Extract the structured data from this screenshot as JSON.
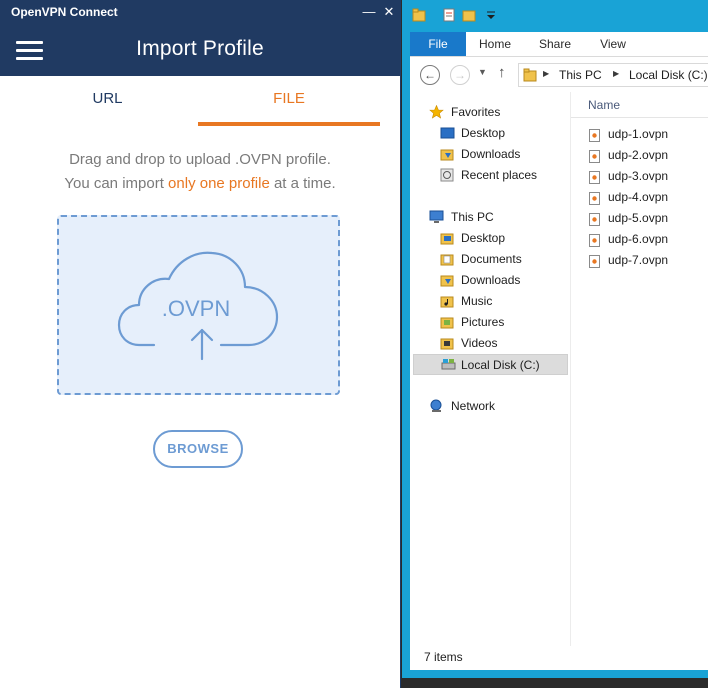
{
  "ovpn": {
    "window_title": "OpenVPN Connect",
    "minimize_glyph": "—",
    "close_glyph": "✕",
    "page_title": "Import Profile",
    "tabs": {
      "url": "URL",
      "file": "FILE"
    },
    "instructions": {
      "line1": "Drag and drop to upload .OVPN profile.",
      "line2_before": "You can import ",
      "line2_highlight": "only one profile",
      "line2_after": " at a time."
    },
    "dropzone_label": ".OVPN",
    "browse_label": "BROWSE",
    "colors": {
      "header": "#203a62",
      "accent": "#e87722",
      "dropzone": "#6d9bd3"
    }
  },
  "explorer": {
    "ribbon_tabs": [
      "File",
      "Home",
      "Share",
      "View"
    ],
    "breadcrumb": [
      "This PC",
      "Local Disk (C:)"
    ],
    "nav": {
      "favorites": {
        "label": "Favorites",
        "items": [
          "Desktop",
          "Downloads",
          "Recent places"
        ]
      },
      "this_pc": {
        "label": "This PC",
        "items": [
          "Desktop",
          "Documents",
          "Downloads",
          "Music",
          "Pictures",
          "Videos",
          "Local Disk (C:)"
        ]
      },
      "network": "Network"
    },
    "column_name": "Name",
    "files": [
      "udp-1.ovpn",
      "udp-2.ovpn",
      "udp-3.ovpn",
      "udp-4.ovpn",
      "udp-5.ovpn",
      "udp-6.ovpn",
      "udp-7.ovpn"
    ],
    "status": "7 items",
    "colors": {
      "frame": "#19a3d6",
      "file_tab": "#1979ca"
    }
  }
}
